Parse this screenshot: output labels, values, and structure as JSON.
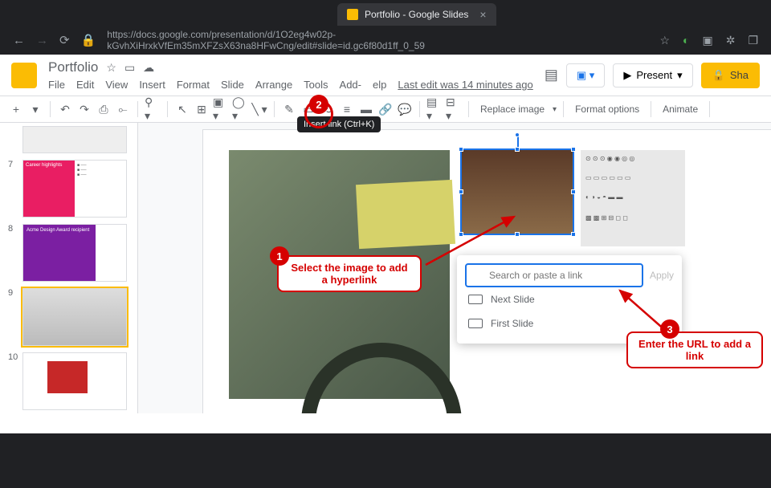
{
  "browser": {
    "tab_title": "Portfolio - Google Slides",
    "url": "https://docs.google.com/presentation/d/1O2eg4w02p-kGvhXiHrxkVfEm35mXFZsX63na8HFwCng/edit#slide=id.gc6f80d1ff_0_59"
  },
  "doc": {
    "title": "Portfolio",
    "last_edit": "Last edit was 14 minutes ago",
    "menus": [
      "File",
      "Edit",
      "View",
      "Insert",
      "Format",
      "Slide",
      "Arrange",
      "Tools",
      "Add-",
      "elp"
    ],
    "present": "Present",
    "share": "Sha"
  },
  "toolbar": {
    "replace_image": "Replace image",
    "format_options": "Format options",
    "animate": "Animate",
    "tooltip": "Insert link (Ctrl+K)"
  },
  "thumbs": {
    "n7": "7",
    "n8": "8",
    "n9": "9",
    "n10": "10",
    "t7a": "Career highlights",
    "t8a": "Acme Design Award recipient"
  },
  "link_popover": {
    "placeholder": "Search or paste a link",
    "apply": "Apply",
    "next_slide": "Next Slide",
    "first_slide": "First Slide"
  },
  "annotations": {
    "b1": "1",
    "t1": "Select the image to add a hyperlink",
    "b2": "2",
    "b3": "3",
    "t3": "Enter the URL to add a link"
  }
}
